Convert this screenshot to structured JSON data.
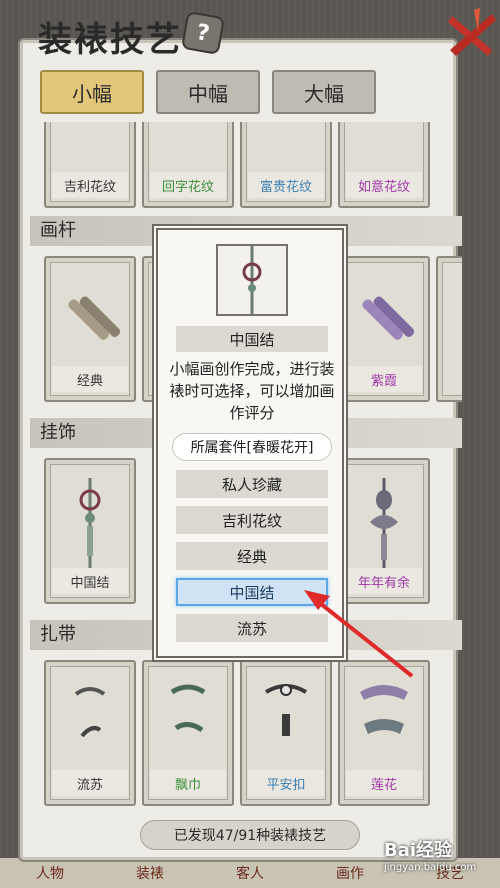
{
  "title": "装裱技艺",
  "size_tabs": [
    "小幅",
    "中幅",
    "大幅"
  ],
  "sections": {
    "pattern_row_labels": [
      "吉利花纹",
      "回字花纹",
      "富贵花纹",
      "如意花纹"
    ],
    "rod": {
      "header": "画杆",
      "cards": [
        "经典",
        "紫霞"
      ]
    },
    "ornament": {
      "header": "挂饰",
      "cards": [
        "中国结",
        "年年有余"
      ]
    },
    "ribbon": {
      "header": "扎带",
      "cards": [
        "流苏",
        "飘巾",
        "平安扣",
        "莲花"
      ]
    }
  },
  "discovered_text": "已发现47/91种装裱技艺",
  "popup": {
    "name": "中国结",
    "description": "小幅画创作完成，进行装裱时可选择，可以增加画作评分",
    "set": "所属套件[春暖花开]",
    "options": [
      "私人珍藏",
      "吉利花纹",
      "经典",
      "中国结",
      "流苏"
    ],
    "selected_index": 3
  },
  "bottom_tabs": [
    "人物",
    "装裱",
    "客人",
    "画作",
    "技艺"
  ],
  "watermark": {
    "brand": "Bai经验",
    "url": "jingyan.baidu.com"
  },
  "colors": {
    "accent_gold": "#e2c77a",
    "selected_blue": "#5aa6e6",
    "arrow_red": "#e02a2a"
  }
}
